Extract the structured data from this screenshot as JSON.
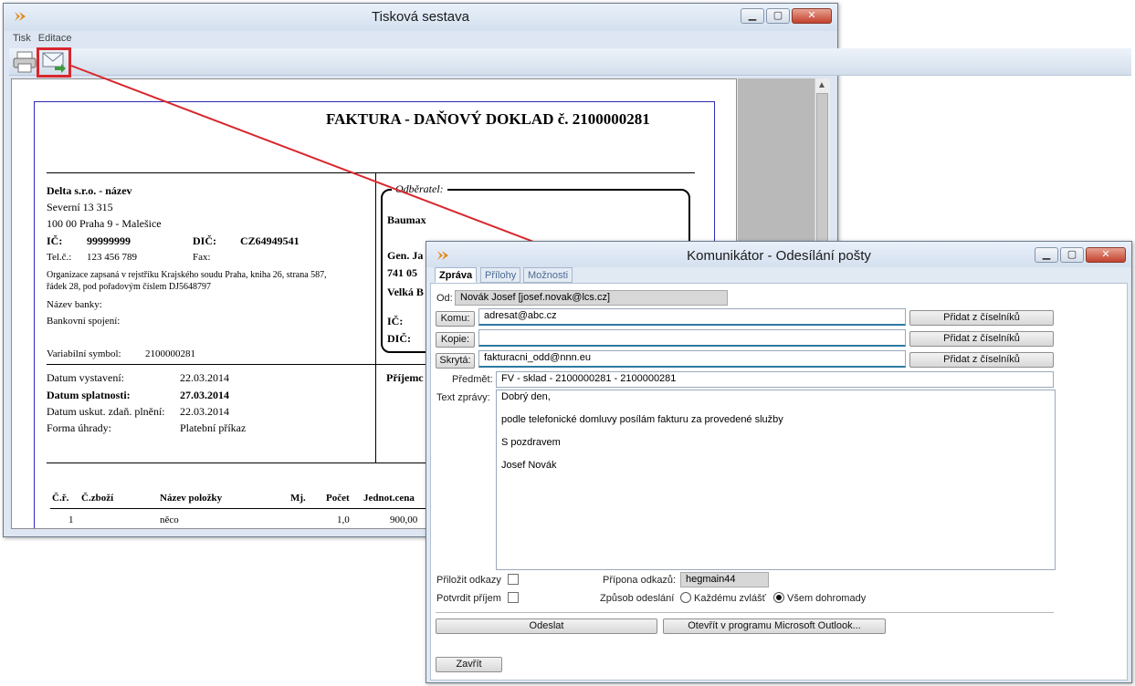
{
  "print_window": {
    "title": "Tisková sestava",
    "menu": [
      "Tisk",
      "Editace"
    ]
  },
  "invoice": {
    "title": "FAKTURA - DAŇOVÝ DOKLAD č. 2100000281",
    "supplier": {
      "name": "Delta s.r.o. - název",
      "street": "Severní 13 315",
      "city": "100 00  Praha 9 - Malešice",
      "ic_label": "IČ:",
      "ic": "99999999",
      "dic_label": "DIČ:",
      "dic": "CZ64949541",
      "tel_label": "Tel.č.:",
      "tel": "123 456 789",
      "fax_label": "Fax:",
      "registry": [
        "Organizace zapsaná v rejstříku Krajského soudu Praha, kniha 26, strana 587,",
        "řádek 28, pod pořadovým číslem DJ5648797"
      ],
      "bank_name": "Název banky:",
      "bank_account": "Bankovní spojení:",
      "var_label": "Variabilní symbol:",
      "var_symbol": "2100000281"
    },
    "customer": {
      "legend": "Odběratel:",
      "name": "Baumax",
      "addr1": "Gen. Ja",
      "addr2": "741 05",
      "addr3": "Velká B",
      "ic": "IČ:",
      "dic": "DIČ:",
      "recipient": "Příjemc"
    },
    "dates": [
      {
        "label": "Datum vystavení:",
        "value": "22.03.2014"
      },
      {
        "label": "Datum splatnosti:",
        "value": "27.03.2014"
      },
      {
        "label": "Datum uskut. zdaň. plnění:",
        "value": "22.03.2014"
      },
      {
        "label": "Forma úhrady:",
        "value": "Platební příkaz"
      }
    ],
    "table_headers": [
      "Č.ř.",
      "Č.zboží",
      "Název položky",
      "Mj.",
      "Počet",
      "Jednot.cena"
    ],
    "rows": [
      [
        "1",
        "",
        "něco",
        "",
        "1,0",
        "900,00"
      ]
    ]
  },
  "comm_window": {
    "title": "Komunikátor - Odesílání pošty",
    "tabs": [
      "Zpráva",
      "Přílohy",
      "Možnosti"
    ],
    "from_label": "Od:",
    "from": "Novák Josef [josef.novak@lcs.cz]",
    "to_btn": "Komu:",
    "to": "adresat@abc.cz",
    "cc_btn": "Kopie:",
    "cc": "",
    "bcc_btn": "Skrytá:",
    "bcc": "fakturacni_odd@nnn.eu",
    "add_btn": "Přidat z číselníků",
    "subject_label": "Předmět:",
    "subject": "FV - sklad - 2100000281 - 2100000281",
    "body_label": "Text zprávy:",
    "body": [
      "Dobrý den,",
      "podle telefonické domluvy posílám fakturu za provedené služby",
      "S pozdravem",
      "Josef Novák"
    ],
    "attach_links": "Přiložit odkazy",
    "confirm": "Potvrdit příjem",
    "suffix_label": "Přípona odkazů:",
    "suffix": "hegmain44",
    "send_mode_label": "Způsob odeslání",
    "mode_each": "Každému zvlášť",
    "mode_all": "Všem dohromady",
    "send_btn": "Odeslat",
    "outlook_btn": "Otevřít v programu Microsoft Outlook...",
    "close_btn": "Zavřít"
  },
  "colors": {
    "highlight": "#d9262d",
    "arrow": "#d9262d"
  }
}
